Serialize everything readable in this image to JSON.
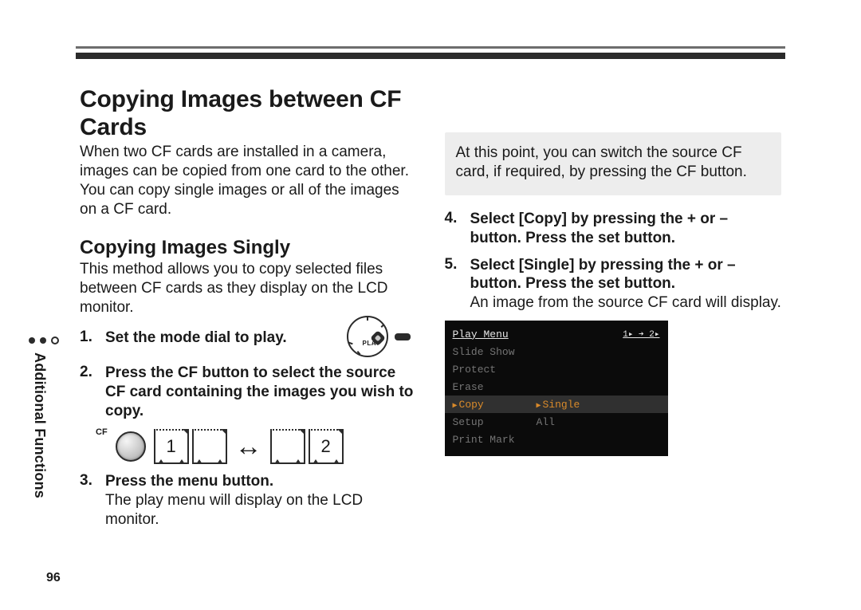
{
  "page_number": "96",
  "side_tab": "Additional Functions",
  "h1": "Copying Images between CF Cards",
  "intro_1": "When two CF cards are installed in a camera, images can be copied from one card to the other. You can copy single images or all of the images on a CF card.",
  "h2": "Copying Images Singly",
  "intro_2": "This method allows you to copy selected files between CF cards as they display on the LCD monitor.",
  "step1_num": "1.",
  "step1_bold": "Set the mode dial to play.",
  "dial_play_label": "PLAY",
  "step2_num": "2.",
  "step2_bold": "Press the CF button to select the source CF card containing the images you wish to copy.",
  "cf_label": "CF",
  "card1": "1",
  "card2": "2",
  "swap": "↔",
  "step3_num": "3.",
  "step3_bold": "Press the menu button.",
  "step3_rest": "The play menu will display on the LCD monitor.",
  "note": "At this point, you can switch the source CF card, if required, by pressing the CF button.",
  "step4_num": "4.",
  "step4_bold": "Select [Copy] by pressing the + or – button. Press the set button.",
  "step5_num": "5.",
  "step5_bold": "Select [Single] by pressing the + or – button. Press the set button.",
  "step5_rest": "An image from the source CF card will display.",
  "lcd": {
    "header": "Play Menu",
    "header_right": "1▸ ➔ 2▸",
    "rows": [
      {
        "c1": "Slide Show",
        "c2": "",
        "dim": true
      },
      {
        "c1": "Protect",
        "c2": "",
        "dim": true
      },
      {
        "c1": "Erase",
        "c2": "",
        "dim": true
      },
      {
        "c1": "Copy",
        "c2": "Single",
        "sel": true
      },
      {
        "c1": "Setup",
        "c2": "All",
        "dim": true
      },
      {
        "c1": "Print Mark",
        "c2": "",
        "dim": true
      }
    ]
  }
}
